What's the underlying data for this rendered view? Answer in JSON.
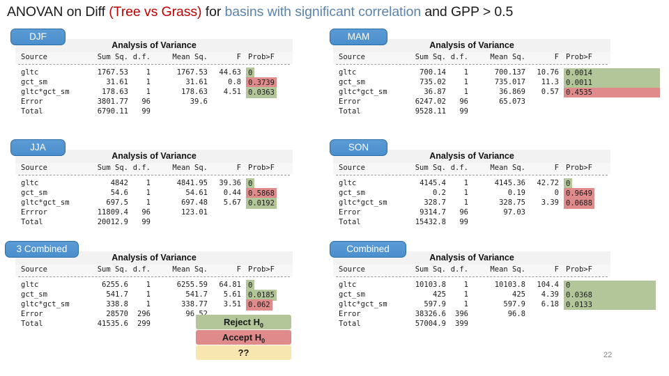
{
  "slide": {
    "title_part1": "ANOVAN on Diff ",
    "title_red": "(Tree vs Grass)",
    "title_part2": " for ",
    "title_blue": "basins with significant correlation",
    "title_part3": " and GPP > 0.5",
    "page_number": "22"
  },
  "table_header": {
    "caption": "Analysis of Variance",
    "source": "Source",
    "sum_sq": "Sum Sq.",
    "df": "d.f.",
    "mean_sq": "Mean Sq.",
    "f": "F",
    "prob": "Prob>F"
  },
  "legend": {
    "items": [
      {
        "label": "Reject H",
        "sub": "0",
        "color": "#b3c69a",
        "name": "reject-h0"
      },
      {
        "label": "Accept H",
        "sub": "0",
        "color": "#df8b8b",
        "name": "accept-h0"
      },
      {
        "label": "??",
        "sub": "",
        "color": "#f7e6b0",
        "name": "unknown"
      }
    ]
  },
  "panels": [
    {
      "id": "djf",
      "tab_label": "DJF",
      "rows": [
        {
          "source": "gltc",
          "sum_sq": "1767.53",
          "df": "1",
          "mean_sq": "1767.53",
          "f": "44.63",
          "prob": "0",
          "mark": "reject"
        },
        {
          "source": "gct_sm",
          "sum_sq": "31.61",
          "df": "1",
          "mean_sq": "31.61",
          "f": "0.8",
          "prob": "0.3739",
          "mark": "accept"
        },
        {
          "source": "gltc*gct_sm",
          "sum_sq": "178.63",
          "df": "1",
          "mean_sq": "178.63",
          "f": "4.51",
          "prob": "0.0363",
          "mark": "reject"
        },
        {
          "source": "Error",
          "sum_sq": "3801.77",
          "df": "96",
          "mean_sq": "39.6",
          "f": "",
          "prob": "",
          "mark": "none"
        },
        {
          "source": "Total",
          "sum_sq": "6790.11",
          "df": "99",
          "mean_sq": "",
          "f": "",
          "prob": "",
          "mark": "none"
        }
      ]
    },
    {
      "id": "mam",
      "tab_label": "MAM",
      "rows": [
        {
          "source": "gltc",
          "sum_sq": "700.14",
          "df": "1",
          "mean_sq": "700.137",
          "f": "10.76",
          "prob": "0.0014",
          "mark": "reject"
        },
        {
          "source": "gct_sm",
          "sum_sq": "735.02",
          "df": "1",
          "mean_sq": "735.017",
          "f": "11.3",
          "prob": "0.0011",
          "mark": "reject"
        },
        {
          "source": "gltc*gct_sm",
          "sum_sq": "36.87",
          "df": "1",
          "mean_sq": "36.869",
          "f": "0.57",
          "prob": "0.4535",
          "mark": "accept"
        },
        {
          "source": "Error",
          "sum_sq": "6247.02",
          "df": "96",
          "mean_sq": "65.073",
          "f": "",
          "prob": "",
          "mark": "none"
        },
        {
          "source": "Total",
          "sum_sq": "9528.11",
          "df": "99",
          "mean_sq": "",
          "f": "",
          "prob": "",
          "mark": "none"
        }
      ]
    },
    {
      "id": "jja",
      "tab_label": "JJA",
      "rows": [
        {
          "source": "gltc",
          "sum_sq": "4842",
          "df": "1",
          "mean_sq": "4841.95",
          "f": "39.36",
          "prob": "0",
          "mark": "reject"
        },
        {
          "source": "gct_sm",
          "sum_sq": "54.6",
          "df": "1",
          "mean_sq": "54.61",
          "f": "0.44",
          "prob": "0.5868",
          "mark": "accept"
        },
        {
          "source": "gltc*gct_sm",
          "sum_sq": "697.5",
          "df": "1",
          "mean_sq": "697.48",
          "f": "5.67",
          "prob": "0.0192",
          "mark": "reject"
        },
        {
          "source": "Errror",
          "sum_sq": "11809.4",
          "df": "96",
          "mean_sq": "123.01",
          "f": "",
          "prob": "",
          "mark": "none"
        },
        {
          "source": "Total",
          "sum_sq": "20012.9",
          "df": "99",
          "mean_sq": "",
          "f": "",
          "prob": "",
          "mark": "none"
        }
      ]
    },
    {
      "id": "son",
      "tab_label": "SON",
      "rows": [
        {
          "source": "gltc",
          "sum_sq": "4145.4",
          "df": "1",
          "mean_sq": "4145.36",
          "f": "42.72",
          "prob": "0",
          "mark": "reject"
        },
        {
          "source": "gct_sm",
          "sum_sq": "0.2",
          "df": "1",
          "mean_sq": "0.19",
          "f": "0",
          "prob": "0.9649",
          "mark": "accept"
        },
        {
          "source": "gltc*gct_sm",
          "sum_sq": "328.7",
          "df": "1",
          "mean_sq": "328.75",
          "f": "3.39",
          "prob": "0.0688",
          "mark": "accept"
        },
        {
          "source": "Error",
          "sum_sq": "9314.7",
          "df": "96",
          "mean_sq": "97.03",
          "f": "",
          "prob": "",
          "mark": "none"
        },
        {
          "source": "Total",
          "sum_sq": "15432.8",
          "df": "99",
          "mean_sq": "",
          "f": "",
          "prob": "",
          "mark": "none"
        }
      ]
    },
    {
      "id": "three-combined",
      "tab_label": "3 Combined",
      "rows": [
        {
          "source": "gltc",
          "sum_sq": "6255.6",
          "df": "1",
          "mean_sq": "6255.59",
          "f": "64.81",
          "prob": "0",
          "mark": "reject"
        },
        {
          "source": "gct_sm",
          "sum_sq": "541.7",
          "df": "1",
          "mean_sq": "541.7",
          "f": "5.61",
          "prob": "0.0185",
          "mark": "reject"
        },
        {
          "source": "gltc*gct_sm",
          "sum_sq": "338.8",
          "df": "1",
          "mean_sq": "338.77",
          "f": "3.51",
          "prob": "0.062",
          "mark": "accept"
        },
        {
          "source": "Error",
          "sum_sq": "28570",
          "df": "296",
          "mean_sq": "96.52",
          "f": "",
          "prob": "",
          "mark": "none"
        },
        {
          "source": "Total",
          "sum_sq": "41535.6",
          "df": "299",
          "mean_sq": "",
          "f": "",
          "prob": "",
          "mark": "none"
        }
      ]
    },
    {
      "id": "combined",
      "tab_label": "Combined",
      "rows": [
        {
          "source": "gltc",
          "sum_sq": "10103.8",
          "df": "1",
          "mean_sq": "10103.8",
          "f": "104.4",
          "prob": "0",
          "mark": "reject"
        },
        {
          "source": "gct_sm",
          "sum_sq": "425",
          "df": "1",
          "mean_sq": "425",
          "f": "4.39",
          "prob": "0.0368",
          "mark": "reject"
        },
        {
          "source": "gltc*gct_sm",
          "sum_sq": "597.9",
          "df": "1",
          "mean_sq": "597.9",
          "f": "6.18",
          "prob": "0.0133",
          "mark": "reject"
        },
        {
          "source": "Error",
          "sum_sq": "38326.6",
          "df": "396",
          "mean_sq": "96.8",
          "f": "",
          "prob": "",
          "mark": "none"
        },
        {
          "source": "Total",
          "sum_sq": "57004.9",
          "df": "399",
          "mean_sq": "",
          "f": "",
          "prob": "",
          "mark": "none"
        }
      ]
    }
  ]
}
